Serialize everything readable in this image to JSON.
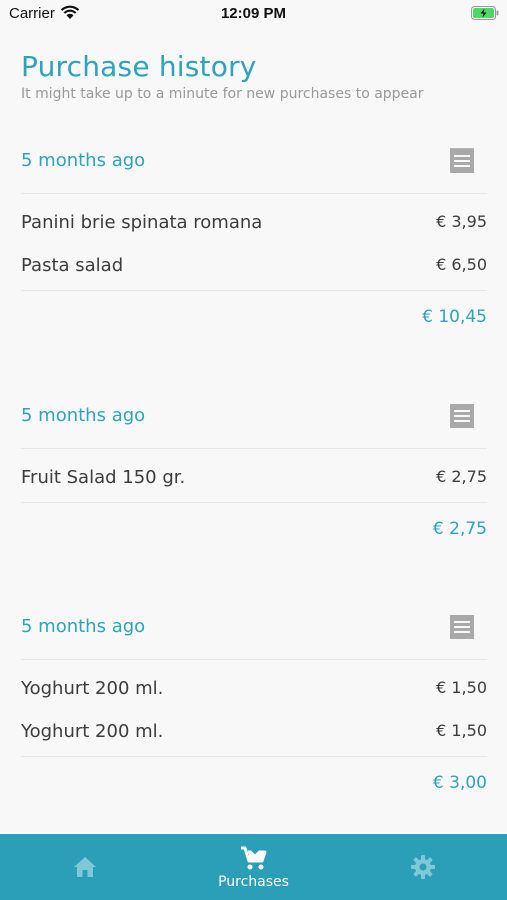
{
  "status_bar": {
    "carrier": "Carrier",
    "time": "12:09 PM",
    "battery_color": "#4cd964"
  },
  "header": {
    "title": "Purchase history",
    "subtitle": "It might take up to a minute for new purchases to appear"
  },
  "purchases": [
    {
      "date": "5 months ago",
      "items": [
        {
          "name": "Panini brie spinata romana",
          "price": "€ 3,95"
        },
        {
          "name": "Pasta salad",
          "price": "€ 6,50"
        }
      ],
      "total": "€ 10,45"
    },
    {
      "date": "5 months ago",
      "items": [
        {
          "name": "Fruit Salad 150 gr.",
          "price": "€ 2,75"
        }
      ],
      "total": "€ 2,75"
    },
    {
      "date": "5 months ago",
      "items": [
        {
          "name": "Yoghurt 200 ml.",
          "price": "€ 1,50"
        },
        {
          "name": "Yoghurt 200 ml.",
          "price": "€ 1,50"
        }
      ],
      "total": "€ 3,00"
    }
  ],
  "tabbar": {
    "tabs": [
      {
        "icon": "home-icon",
        "label": ""
      },
      {
        "icon": "cart-icon",
        "label": "Purchases",
        "active": true
      },
      {
        "icon": "gear-icon",
        "label": ""
      }
    ],
    "background": "#2b9fb8"
  },
  "colors": {
    "accent": "#2fa3bb",
    "text": "#3c3c3c",
    "muted": "#9a9a9a"
  }
}
